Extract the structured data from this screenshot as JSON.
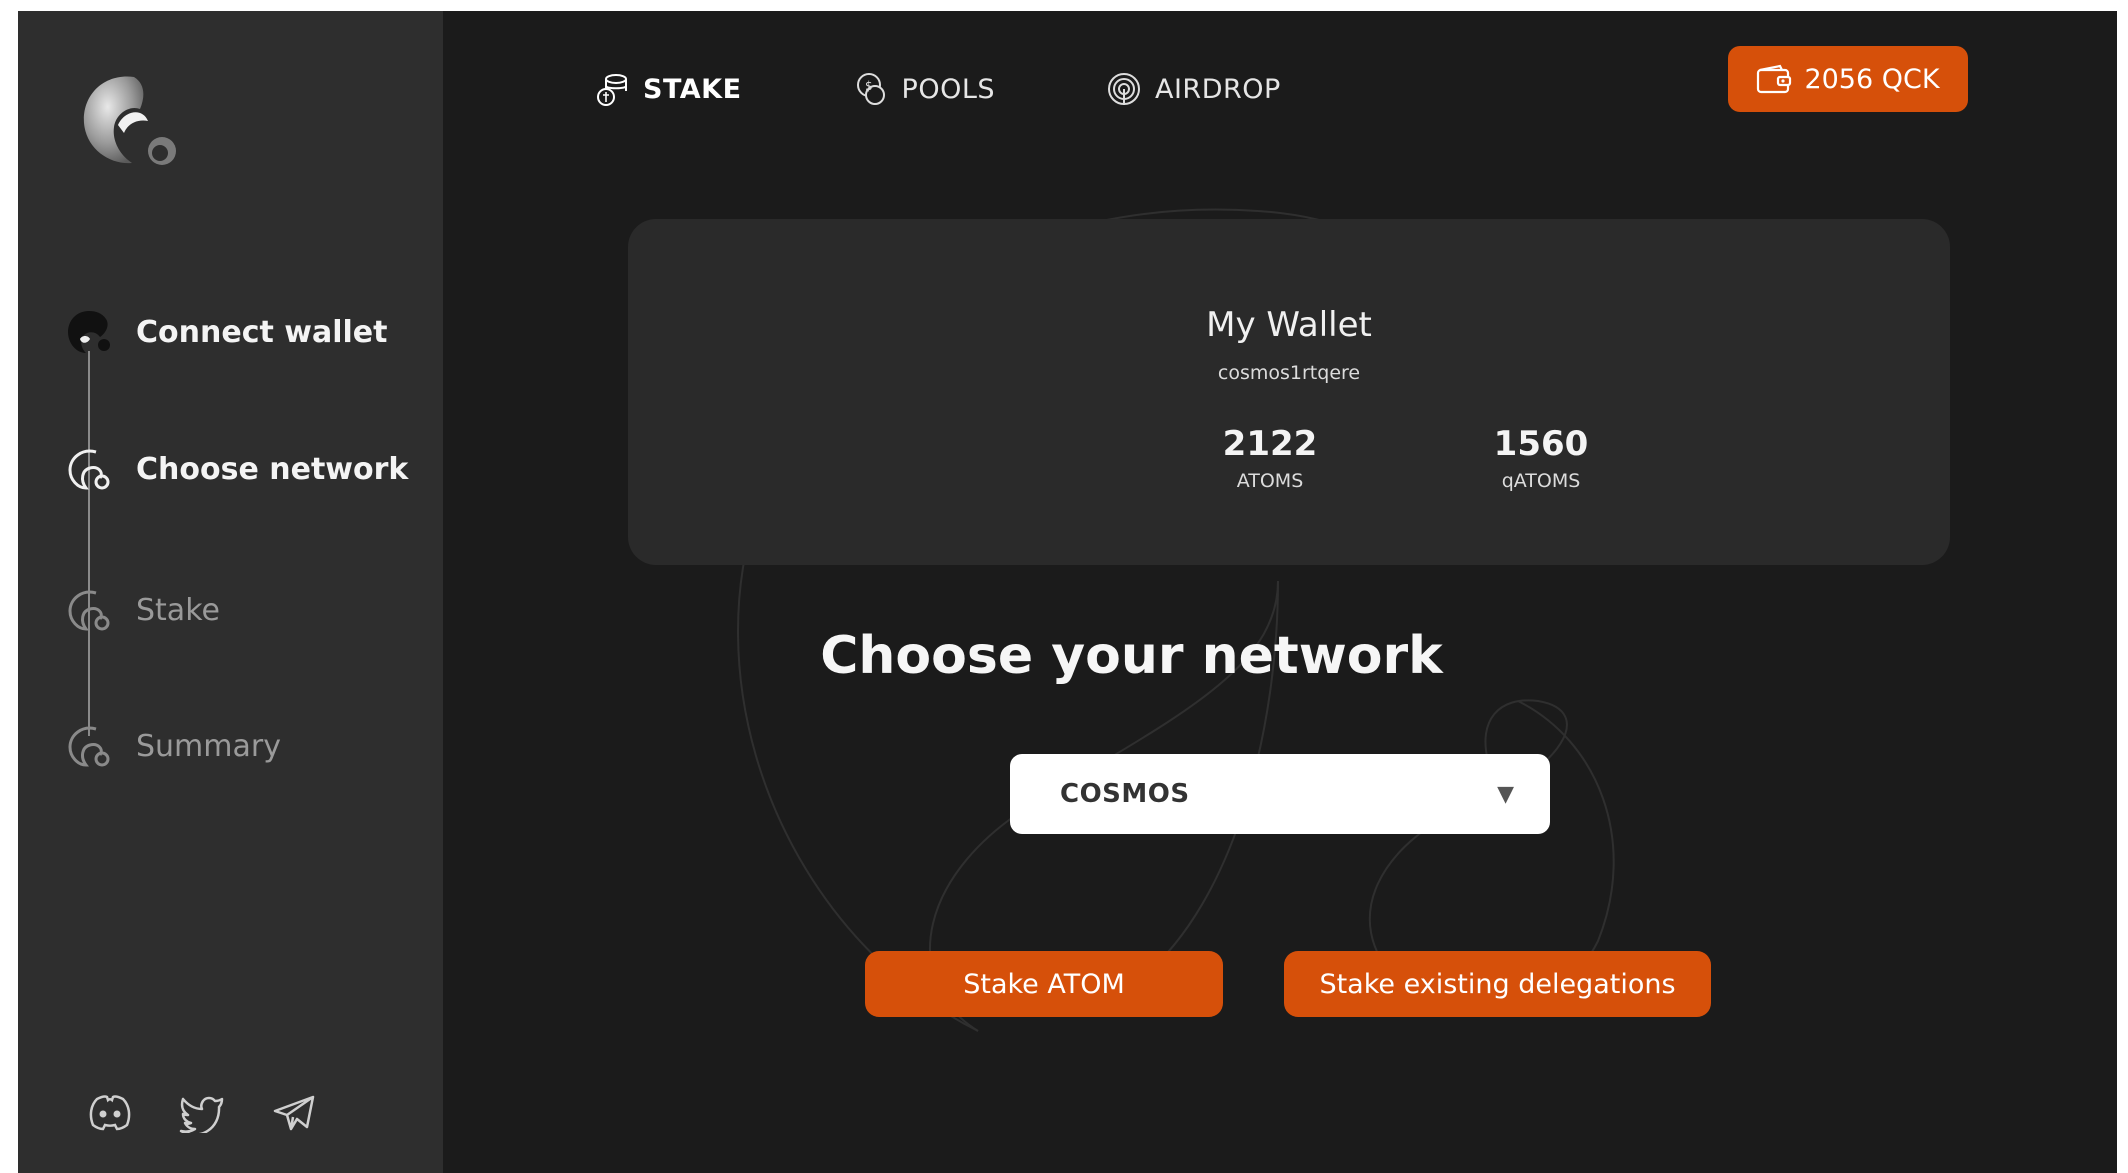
{
  "nav": {
    "items": [
      {
        "label": "STAKE",
        "icon": "coins-stack-icon",
        "active": true
      },
      {
        "label": "POOLS",
        "icon": "pools-icon",
        "active": false
      },
      {
        "label": "AIRDROP",
        "icon": "airdrop-icon",
        "active": false
      }
    ],
    "balance": {
      "label": "2056 QCK",
      "icon": "wallet-icon"
    }
  },
  "sidebar": {
    "steps": [
      {
        "label": "Connect wallet",
        "state": "active"
      },
      {
        "label": "Choose network",
        "state": "active"
      },
      {
        "label": "Stake",
        "state": "inactive"
      },
      {
        "label": "Summary",
        "state": "inactive"
      }
    ],
    "socials": [
      "discord-icon",
      "twitter-icon",
      "telegram-icon"
    ]
  },
  "wallet": {
    "title": "My Wallet",
    "address": "cosmos1rtqere",
    "stats": [
      {
        "value": "2122",
        "unit": "ATOMS"
      },
      {
        "value": "1560",
        "unit": "qATOMS"
      }
    ]
  },
  "main": {
    "heading": "Choose your network",
    "network_select": {
      "value": "COSMOS"
    },
    "buttons": {
      "stake_atom": "Stake ATOM",
      "stake_existing": "Stake existing delegations"
    }
  },
  "colors": {
    "accent": "#d6500a",
    "background": "#1b1b1b",
    "sidebar": "#2e2e2e",
    "card": "#2a2a2a"
  }
}
